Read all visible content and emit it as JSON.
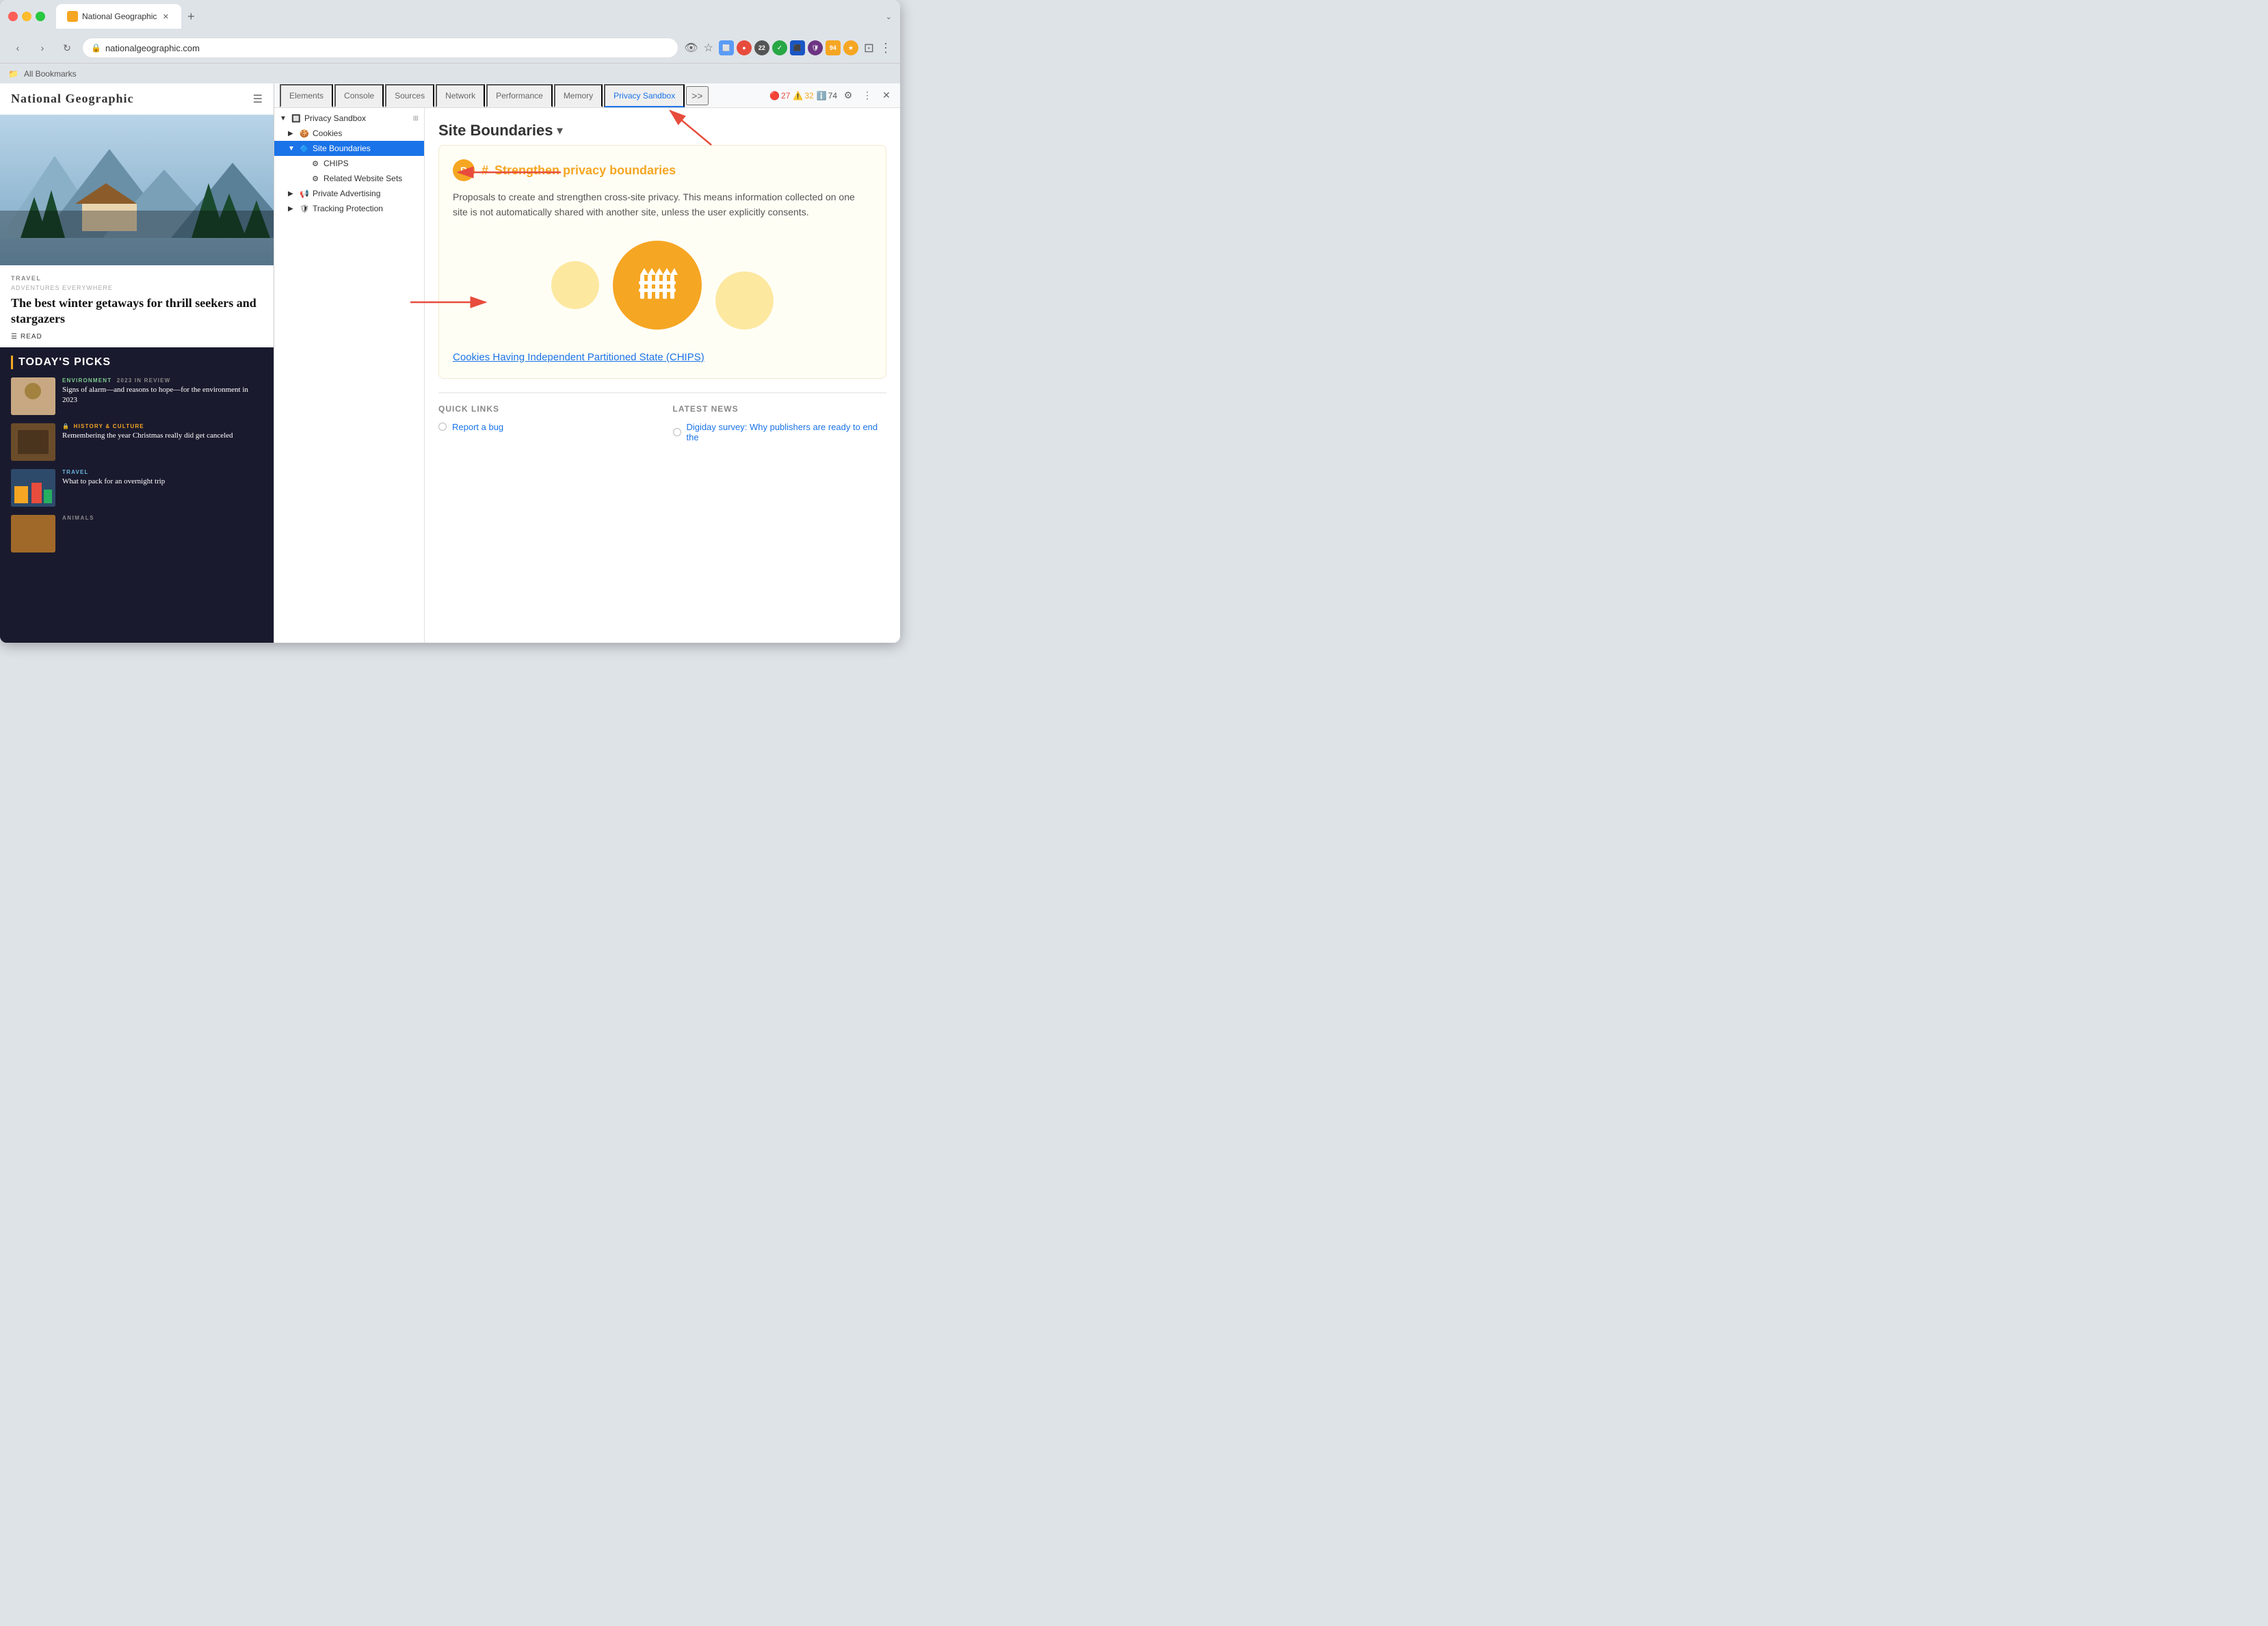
{
  "browser": {
    "tab_title": "National Geographic",
    "address": "nationalgeographic.com",
    "bookmarks_label": "All Bookmarks"
  },
  "devtools": {
    "tabs": [
      "Elements",
      "Console",
      "Sources",
      "Network",
      "Performance",
      "Memory",
      "Privacy Sandbox"
    ],
    "active_tab": "Privacy Sandbox",
    "more_tabs": ">>",
    "error_count": "27",
    "warning_count": "32",
    "info_count": "74"
  },
  "tree": {
    "items": [
      {
        "id": "privacy-sandbox",
        "label": "Privacy Sandbox",
        "level": 0,
        "expanded": true,
        "icon": "🔲"
      },
      {
        "id": "cookies",
        "label": "Cookies",
        "level": 1,
        "expanded": false,
        "icon": "🍪"
      },
      {
        "id": "site-boundaries",
        "label": "Site Boundaries",
        "level": 1,
        "expanded": true,
        "selected": true,
        "icon": "🔷"
      },
      {
        "id": "chips",
        "label": "CHIPS",
        "level": 2,
        "icon": "⚙️"
      },
      {
        "id": "related-website-sets",
        "label": "Related Website Sets",
        "level": 2,
        "icon": "⚙️"
      },
      {
        "id": "private-advertising",
        "label": "Private Advertising",
        "level": 1,
        "icon": "📢",
        "expanded": false
      },
      {
        "id": "tracking-protection",
        "label": "Tracking Protection",
        "level": 1,
        "icon": "🛡️",
        "expanded": false
      }
    ]
  },
  "content": {
    "section_title": "Site Boundaries",
    "section_dropdown": "▾",
    "card_title": "Strengthen privacy boundaries",
    "card_hash": "#",
    "card_icon": "B",
    "card_body": "Proposals to create and strengthen cross-site privacy. This means information collected on one site is not automatically shared with another site, unless the user explicitly consents.",
    "chips_link": "Cookies Having Independent Partitioned State (CHIPS)",
    "quick_links_title": "QUICK LINKS",
    "latest_news_title": "LATEST NEWS",
    "report_bug": "Report a bug",
    "latest_news_item": "Digiday survey: Why publishers are ready to end the"
  },
  "website": {
    "logo": "National Geographic",
    "hero_tag": "TRAVEL",
    "hero_subtitle": "ADVENTURES EVERYWHERE",
    "hero_title": "The best winter getaways for thrill seekers and stargazers",
    "hero_read": "READ",
    "picks_title": "TODAY'S PICKS",
    "picks": [
      {
        "tag": "ENVIRONMENT",
        "tag2": "2023 IN REVIEW",
        "title": "Signs of alarm—and reasons to hope—for the environment in 2023",
        "thumb_class": "pick-thumb-env"
      },
      {
        "tag": "HISTORY & CULTURE",
        "title": "Remembering the year Christmas really did get canceled",
        "thumb_class": "pick-thumb-hist",
        "has_lock": true
      },
      {
        "tag": "TRAVEL",
        "title": "What to pack for an overnight trip",
        "thumb_class": "pick-thumb-travel"
      }
    ],
    "animals_tag": "ANIMALS"
  }
}
